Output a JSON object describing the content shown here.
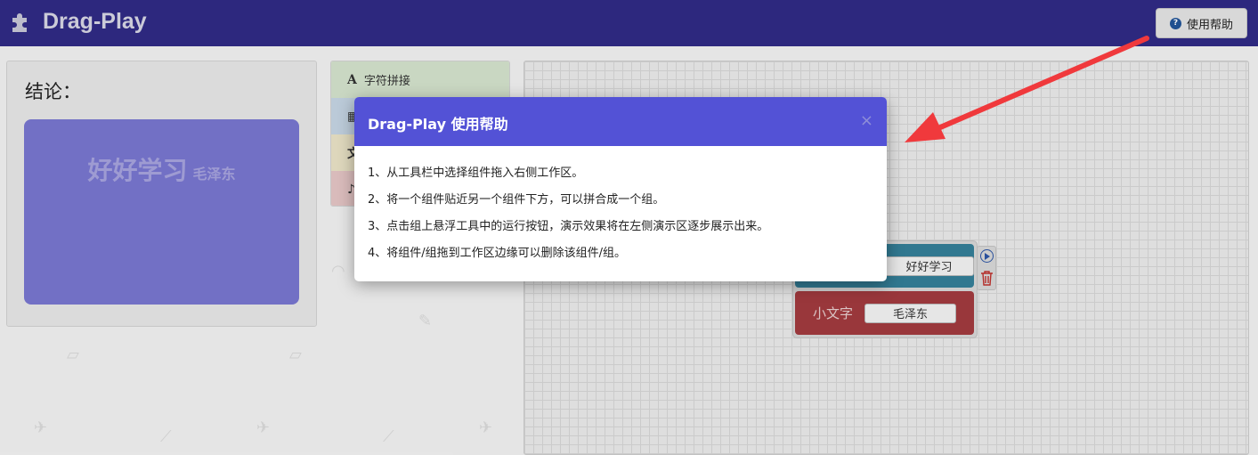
{
  "header": {
    "title": "Drag-Play",
    "help_button": "使用帮助"
  },
  "result": {
    "heading": "结论：",
    "big_text": "好好学习",
    "small_text": "毛泽东"
  },
  "toolbox": {
    "items": [
      {
        "icon": "A",
        "label": "字符拼接"
      },
      {
        "icon": "▦",
        "label": ""
      },
      {
        "icon": "文",
        "label": ""
      },
      {
        "icon": "♪",
        "label": ""
      }
    ]
  },
  "workspace": {
    "blocks": [
      {
        "label": "",
        "value": "好好学习"
      },
      {
        "label": "小文字",
        "value": "毛泽东"
      }
    ]
  },
  "modal": {
    "title": "Drag-Play 使用帮助",
    "close": "×",
    "lines": [
      "1、从工具栏中选择组件拖入右侧工作区。",
      "2、将一个组件贴近另一个组件下方，可以拼合成一个组。",
      "3、点击组上悬浮工具中的运行按钮，演示效果将在左侧演示区逐步展示出来。",
      "4、将组件/组拖到工作区边缘可以删除该组件/组。"
    ]
  },
  "colors": {
    "header": "#302b86",
    "modal_header": "#5352d6",
    "stage": "#7a78d2",
    "arrow": "#f0393c"
  }
}
